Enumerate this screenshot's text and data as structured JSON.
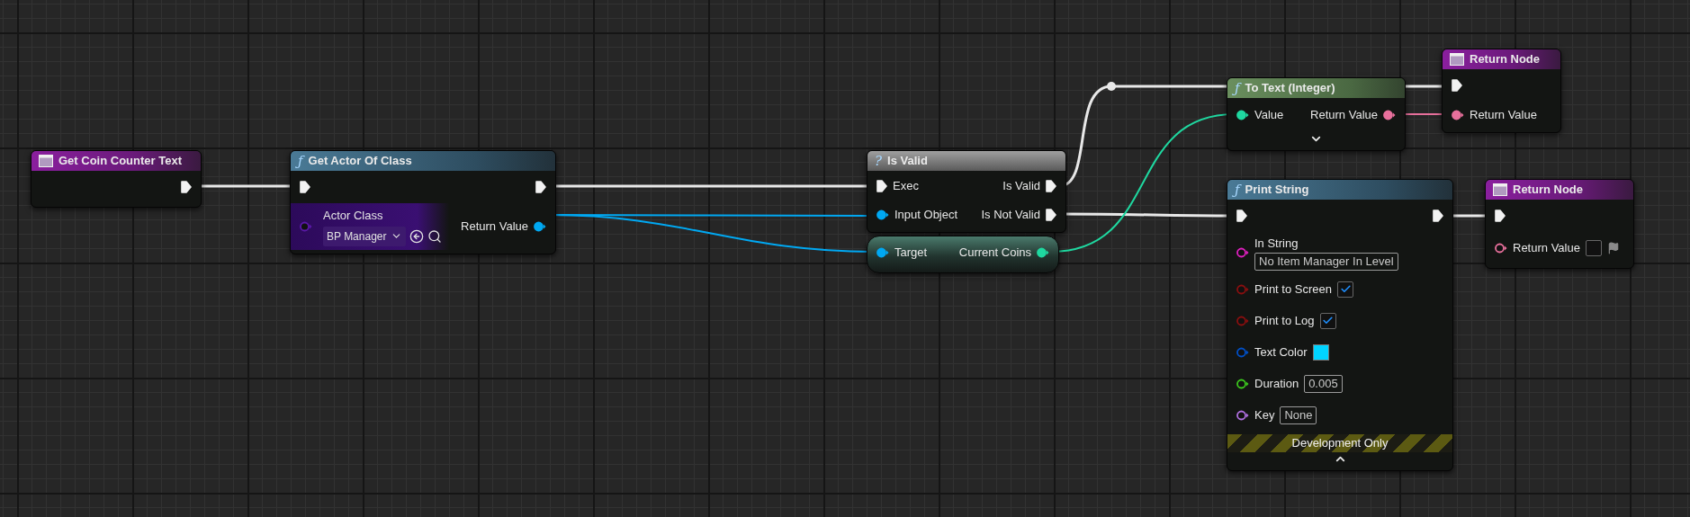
{
  "graph": {
    "nodes": [
      {
        "kind": "event",
        "title": "Get Coin Counter Text",
        "rows": [
          {
            "right": {
              "kind": "exec",
              "connected": true
            }
          }
        ]
      },
      {
        "kind": "function",
        "glyph": "ƒ",
        "title": "Get Actor Of Class",
        "rows": [
          {
            "left": {
              "kind": "exec",
              "connected": true
            },
            "right": {
              "kind": "exec",
              "connected": true
            }
          },
          {
            "left": {
              "kind": "data",
              "color": "#5a18a8",
              "connected": false,
              "label": "Actor Class",
              "input": {
                "kind": "class",
                "value": "BP Manager"
              }
            },
            "right": {
              "kind": "data",
              "color": "#00a8f2",
              "connected": true,
              "label": "Return Value"
            }
          }
        ]
      },
      {
        "kind": "macro",
        "glyph": "?",
        "title": "Is Valid",
        "rows": [
          {
            "left": {
              "kind": "exec",
              "connected": true,
              "label": "Exec"
            },
            "right": {
              "kind": "exec",
              "connected": true,
              "label": "Is Valid"
            }
          },
          {
            "left": {
              "kind": "data",
              "color": "#00a8f2",
              "connected": true,
              "label": "Input Object"
            },
            "right": {
              "kind": "exec",
              "connected": true,
              "label": "Is Not Valid"
            }
          }
        ]
      },
      {
        "kind": "getter",
        "rows": [
          {
            "left": {
              "kind": "data",
              "color": "#00a8f2",
              "connected": true,
              "label": "Target"
            },
            "right": {
              "kind": "data",
              "color": "#1fd8a0",
              "connected": true,
              "label": "Current Coins"
            }
          }
        ]
      },
      {
        "kind": "pure",
        "glyph": "ƒ",
        "title": "To Text (Integer)",
        "advanced_expanded": false,
        "rows": [
          {
            "left": {
              "kind": "data",
              "color": "#1fd8a0",
              "connected": true,
              "label": "Value"
            },
            "right": {
              "kind": "data",
              "color": "#e8709c",
              "connected": true,
              "label": "Return Value"
            }
          }
        ]
      },
      {
        "kind": "event",
        "title": "Return Node",
        "rows": [
          {
            "left": {
              "kind": "exec",
              "connected": true
            }
          },
          {
            "left": {
              "kind": "data",
              "color": "#e8709c",
              "connected": true,
              "label": "Return Value"
            }
          }
        ]
      },
      {
        "kind": "function",
        "glyph": "ƒ",
        "title": "Print String",
        "advanced_expanded": true,
        "banner": "Development Only",
        "rows": [
          {
            "left": {
              "kind": "exec",
              "connected": true
            },
            "right": {
              "kind": "exec",
              "connected": true
            }
          },
          {
            "left": {
              "kind": "data",
              "color": "#e020c0",
              "connected": false,
              "label": "In String",
              "input": {
                "kind": "text",
                "stacked": true,
                "value": "No Item Manager In Level"
              }
            }
          },
          {
            "left": {
              "kind": "data",
              "color": "#8a0f0f",
              "connected": false,
              "label": "Print to Screen",
              "input": {
                "kind": "checkbox",
                "checked": true
              }
            }
          },
          {
            "left": {
              "kind": "data",
              "color": "#8a0f0f",
              "connected": false,
              "label": "Print to Log",
              "input": {
                "kind": "checkbox",
                "checked": true
              }
            }
          },
          {
            "left": {
              "kind": "data",
              "color": "#0050c8",
              "connected": false,
              "label": "Text Color",
              "input": {
                "kind": "color",
                "color": "#00d4ff"
              }
            }
          },
          {
            "left": {
              "kind": "data",
              "color": "#3cc81e",
              "connected": false,
              "label": "Duration",
              "input": {
                "kind": "text",
                "value": "0.005"
              }
            }
          },
          {
            "left": {
              "kind": "data",
              "color": "#b070e0",
              "connected": false,
              "label": "Key",
              "input": {
                "kind": "text",
                "value": "None"
              }
            }
          }
        ]
      },
      {
        "kind": "event",
        "title": "Return Node",
        "rows": [
          {
            "left": {
              "kind": "exec",
              "connected": true
            }
          },
          {
            "left": {
              "kind": "data",
              "color": "#e8709c",
              "connected": false,
              "label": "Return Value",
              "input": {
                "kind": "flagbox",
                "checked": false
              }
            }
          }
        ]
      }
    ]
  }
}
